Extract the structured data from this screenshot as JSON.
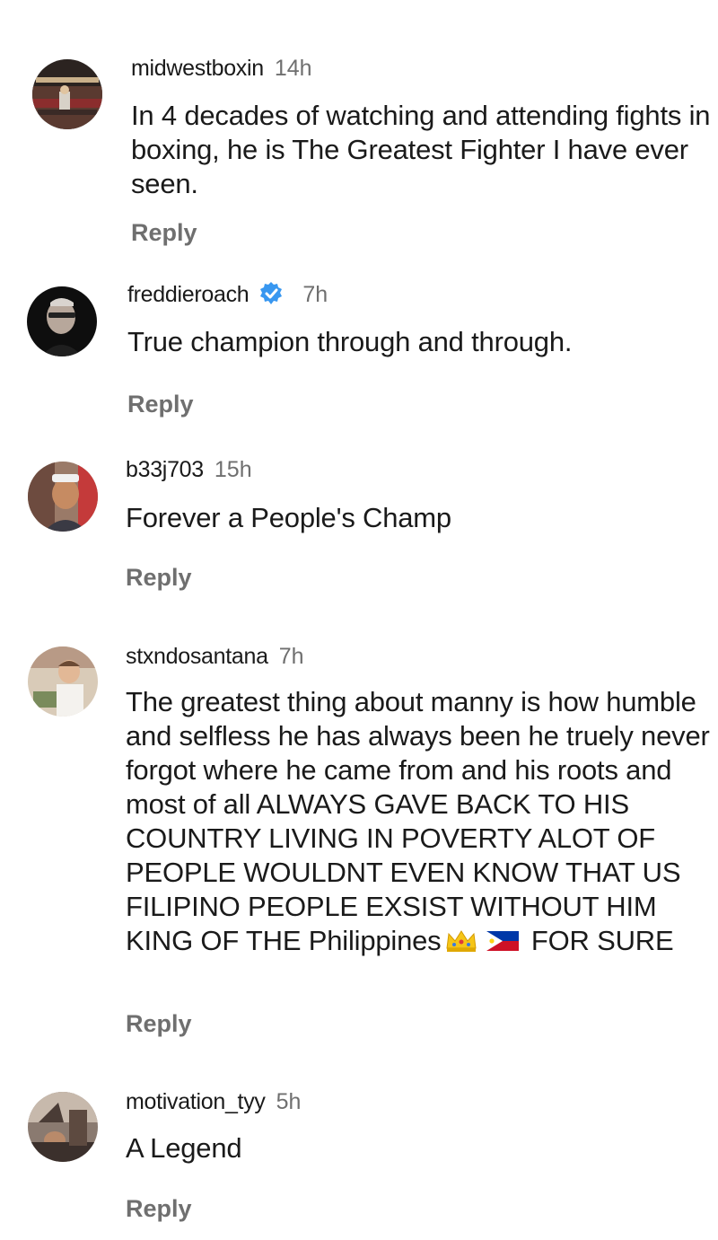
{
  "comments": [
    {
      "username": "midwestboxin",
      "time": "14h",
      "text": "In 4 decades of watching  and attending fights in boxing, he is The Greatest Fighter I have ever seen.",
      "reply": "Reply",
      "verified": false
    },
    {
      "username": "freddieroach",
      "time": "7h",
      "text": "True champion through and through.",
      "reply": "Reply",
      "verified": true
    },
    {
      "username": "b33j703",
      "time": "15h",
      "text": "Forever a People's Champ",
      "reply": "Reply",
      "verified": false
    },
    {
      "username": "stxndosantana",
      "time": "7h",
      "text": "The greatest thing about manny is how humble and selfless he has always been he truely never forgot where he came from and his roots and most of all ALWAYS GAVE BACK TO HIS COUNTRY LIVING IN POVERTY ALOT OF PEOPLE WOULDNT EVEN KNOW THAT US FILIPINO PEOPLE EXSIST WITHOUT HIM KING OF THE",
      "text_tail_start": "Philippines",
      "text_tail_end": "FOR SURE",
      "emojis": [
        "crown-emoji",
        "philippines-flag-emoji"
      ],
      "reply": "Reply",
      "verified": false
    },
    {
      "username": "motivation_tyy",
      "time": "5h",
      "text": "A Legend",
      "reply": "Reply",
      "verified": false
    }
  ],
  "icons": {
    "verified": "verified-badge-icon"
  },
  "colors": {
    "text": "#1a1a1a",
    "muted": "#6f6f6f",
    "verified": "#3897f0"
  }
}
